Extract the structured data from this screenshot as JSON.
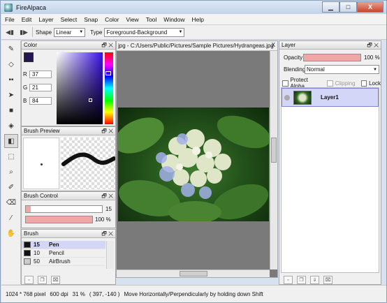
{
  "window": {
    "title": "FireAlpaca",
    "min": "▁",
    "max": "□",
    "close": "X"
  },
  "menu": [
    "File",
    "Edit",
    "Layer",
    "Select",
    "Snap",
    "Color",
    "View",
    "Tool",
    "Window",
    "Help"
  ],
  "toolbar": {
    "shape_label": "Shape",
    "shape_value": "Linear",
    "type_label": "Type",
    "type_value": "Foreground-Background"
  },
  "color_panel": {
    "title": "Color",
    "r_label": "R",
    "r": "37",
    "g_label": "G",
    "g": "21",
    "b_label": "B",
    "b": "84",
    "fg_color": "#251554"
  },
  "brush_preview": {
    "title": "Brush Preview"
  },
  "brush_control": {
    "title": "Brush Control",
    "size": "15",
    "opacity": "100 %",
    "size_level": 0.06,
    "opacity_level": 1.0
  },
  "brush_panel": {
    "title": "Brush",
    "items": [
      {
        "size": "15",
        "name": "Pen"
      },
      {
        "size": "10",
        "name": "Pencil"
      },
      {
        "size": "50",
        "name": "AirBrush"
      }
    ]
  },
  "canvas": {
    "tab_path": "jpg - C:/Users/Public/Pictures/Sample Pictures/Hydrangeas.jpg",
    "close": "X"
  },
  "layer_panel": {
    "title": "Layer",
    "opacity_label": "Opacity",
    "opacity_value": "100 %",
    "blending_label": "Blending",
    "blending_value": "Normal",
    "protect_alpha": "Protect Alpha",
    "clipping": "Clipping",
    "lock": "Lock",
    "layers": [
      {
        "name": "Layer1"
      }
    ]
  },
  "status": {
    "size": "1024 * 768 pixel",
    "dpi": "600 dpi",
    "zoom": "31 %",
    "coords": "( 397, -140 )",
    "hint": "Move Horizontally/Perpendicularly by holding down Shift"
  },
  "panel_ctl": "🗗 ✕"
}
